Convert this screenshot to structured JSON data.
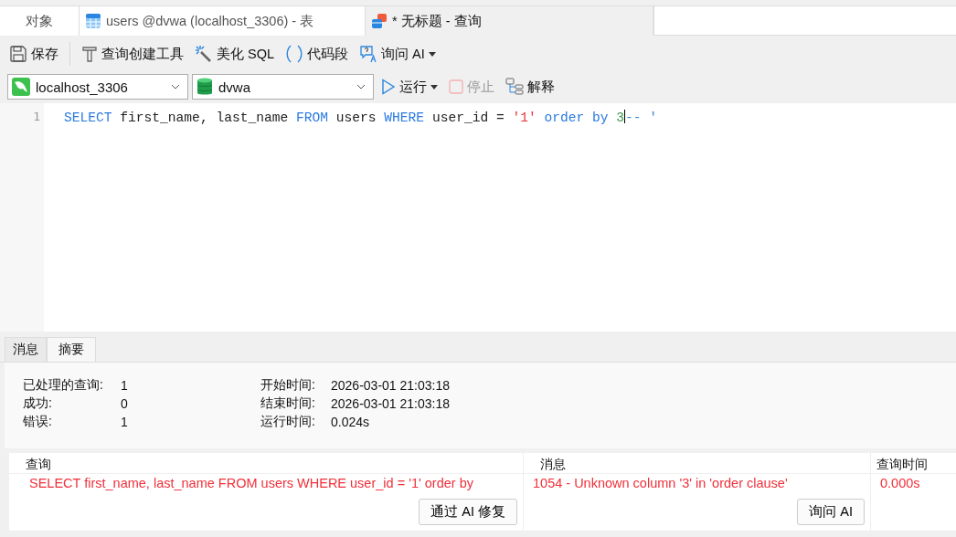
{
  "tabs": [
    {
      "label": "对象",
      "kind": "plain",
      "selected": false
    },
    {
      "label": "users @dvwa (localhost_3306) - 表",
      "kind": "table",
      "selected": false
    },
    {
      "label": "* 无标题 - 查询",
      "kind": "query",
      "selected": true
    }
  ],
  "toolbar": [
    {
      "label": "保存",
      "kind": "save",
      "dropdown": false
    },
    {
      "label": "查询创建工具",
      "kind": "builder",
      "dropdown": false
    },
    {
      "label": "美化 SQL",
      "kind": "beautify",
      "dropdown": false
    },
    {
      "label": "代码段",
      "kind": "snippet",
      "dropdown": false
    },
    {
      "label": "询问 AI",
      "kind": "ai",
      "dropdown": true
    }
  ],
  "connection": {
    "value": "localhost_3306"
  },
  "database": {
    "value": "dvwa"
  },
  "actions": [
    {
      "label": "运行",
      "kind": "run",
      "dropdown": true,
      "disabled": false
    },
    {
      "label": "停止",
      "kind": "stop",
      "dropdown": false,
      "disabled": true
    },
    {
      "label": "解释",
      "kind": "explain",
      "dropdown": false,
      "disabled": false
    }
  ],
  "editor": {
    "lines": [
      {
        "number": "1",
        "tokens": [
          {
            "text": "SELECT",
            "kind": "keyword"
          },
          {
            "text": " first_name, last_name ",
            "kind": "plain"
          },
          {
            "text": "FROM",
            "kind": "keyword"
          },
          {
            "text": " users ",
            "kind": "plain"
          },
          {
            "text": "WHERE",
            "kind": "keyword"
          },
          {
            "text": " user_id = ",
            "kind": "plain"
          },
          {
            "text": "'1'",
            "kind": "string"
          },
          {
            "text": " order by ",
            "kind": "keyword"
          },
          {
            "text": "3",
            "kind": "number",
            "caret": true
          },
          {
            "text": "-- '",
            "kind": "comment"
          }
        ]
      }
    ]
  },
  "result_tabs": [
    {
      "label": "消息",
      "selected": false
    },
    {
      "label": "摘要",
      "selected": true
    }
  ],
  "summary": {
    "left": [
      {
        "label": "已处理的查询:",
        "value": "1"
      },
      {
        "label": "成功:",
        "value": "0"
      },
      {
        "label": "错误:",
        "value": "1"
      }
    ],
    "right": [
      {
        "label": "开始时间:",
        "value": "2026-03-01 21:03:18"
      },
      {
        "label": "结束时间:",
        "value": "2026-03-01 21:03:18"
      },
      {
        "label": "运行时间:",
        "value": "0.024s"
      }
    ]
  },
  "results": {
    "columns": [
      "查询",
      "消息",
      "查询时间"
    ],
    "rows": [
      {
        "error": true,
        "cells": [
          {
            "text": "SELECT first_name, last_name FROM users WHERE user_id = '1' order by",
            "button": "通过 AI 修复"
          },
          {
            "text": "1054 - Unknown column '3' in 'order clause'",
            "button": "询问 AI"
          },
          {
            "text": "0.000s"
          }
        ]
      }
    ]
  }
}
